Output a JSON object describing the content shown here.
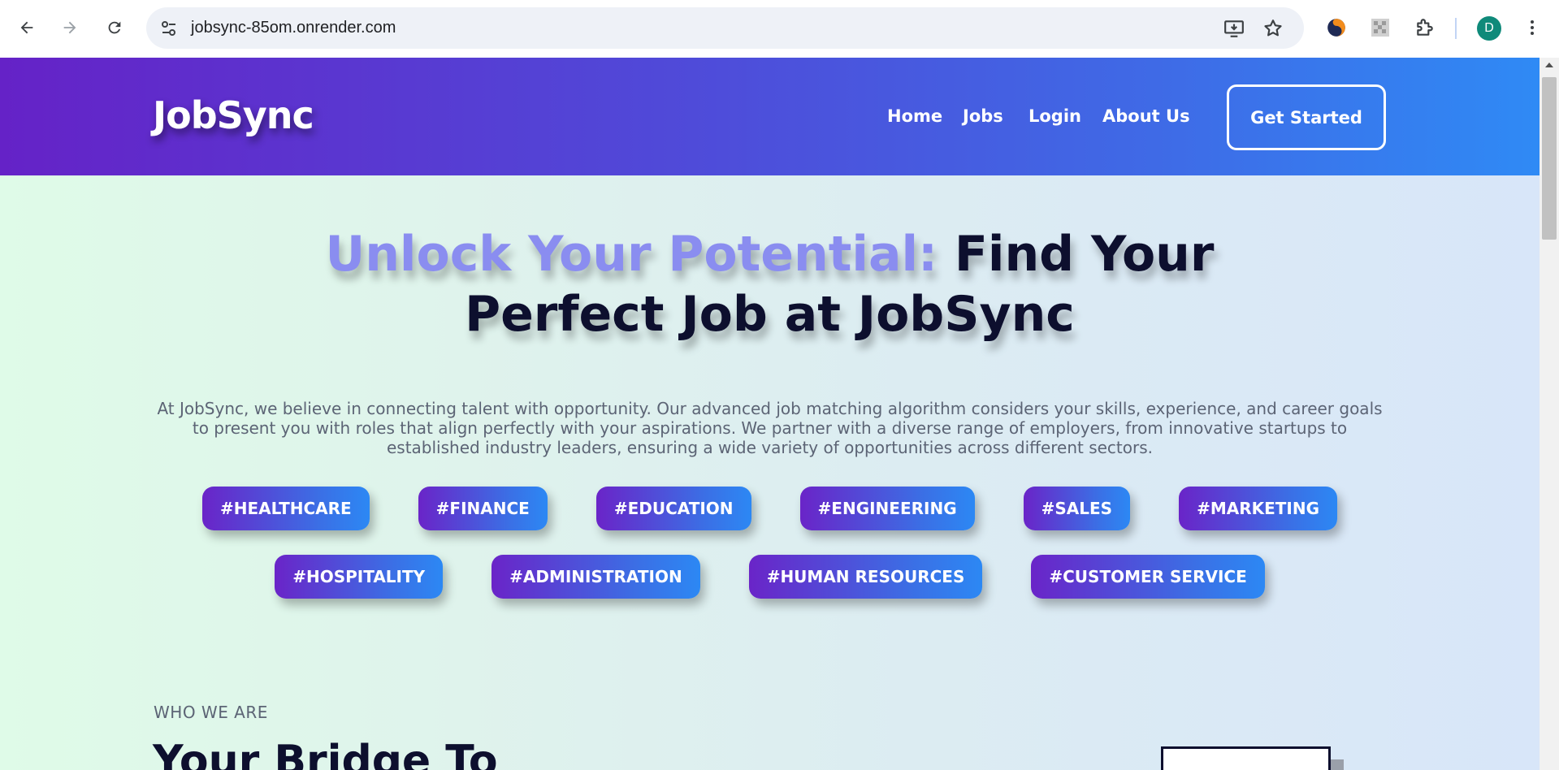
{
  "browser": {
    "url": "jobsync-85om.onrender.com",
    "profile_initial": "D",
    "icons": [
      "back-arrow-icon",
      "forward-arrow-icon",
      "reload-icon",
      "site-settings-icon",
      "install-app-icon",
      "bookmark-star-icon",
      "extension-icon",
      "puzzle-icon",
      "more-vert-icon"
    ]
  },
  "site": {
    "logo": "JobSync",
    "nav": [
      "Home",
      "Jobs",
      "Login",
      "About Us"
    ],
    "cta": "Get Started"
  },
  "hero": {
    "title_accent": "Unlock Your Potential:",
    "title_line1_rest": " Find Your",
    "title_line2": "Perfect Job at JobSync",
    "description": "At JobSync, we believe in connecting talent with opportunity. Our advanced job matching algorithm considers your skills, experience, and career goals to present you with roles that align perfectly with your aspirations. We partner with a diverse range of employers, from innovative startups to established industry leaders, ensuring a wide variety of opportunities across different sectors.",
    "tags_row1": [
      "#HEALTHCARE",
      "#FINANCE",
      "#EDUCATION",
      "#ENGINEERING",
      "#SALES",
      "#MARKETING"
    ],
    "tags_row2": [
      "#HOSPITALITY",
      "#ADMINISTRATION",
      "#HUMAN RESOURCES",
      "#CUSTOMER SERVICE"
    ]
  },
  "about": {
    "eyebrow": "WHO WE ARE",
    "heading": "Your Bridge To"
  },
  "colors": {
    "header_start": "#6522c7",
    "header_end": "#2f8af5",
    "accent_title": "#8a8df0",
    "dark_text": "#0d0f2e"
  }
}
